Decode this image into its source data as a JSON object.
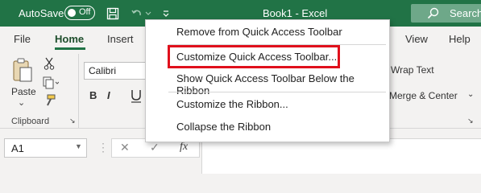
{
  "titlebar": {
    "autosave_label": "AutoSave",
    "toggle_state": "Off",
    "title": "Book1  -  Excel",
    "search_label": "Search"
  },
  "tabs": [
    "File",
    "Home",
    "Insert",
    "View",
    "Help"
  ],
  "ribbon": {
    "paste_label": "Paste",
    "clipboard_label": "Clipboard",
    "font_name": "Calibri",
    "bold": "B",
    "italic": "I",
    "wrap_text": "Wrap Text",
    "merge_center": "Merge & Center"
  },
  "formula_bar": {
    "namebox_value": "A1",
    "fx_label": "fx"
  },
  "context_menu": {
    "items": [
      "Remove from Quick Access Toolbar",
      "Customize Quick Access Toolbar...",
      "Show Quick Access Toolbar Below the Ribbon",
      "Customize the Ribbon...",
      "Collapse the Ribbon"
    ]
  },
  "colors": {
    "excel_green": "#217346",
    "highlight_red": "#e0101c"
  }
}
